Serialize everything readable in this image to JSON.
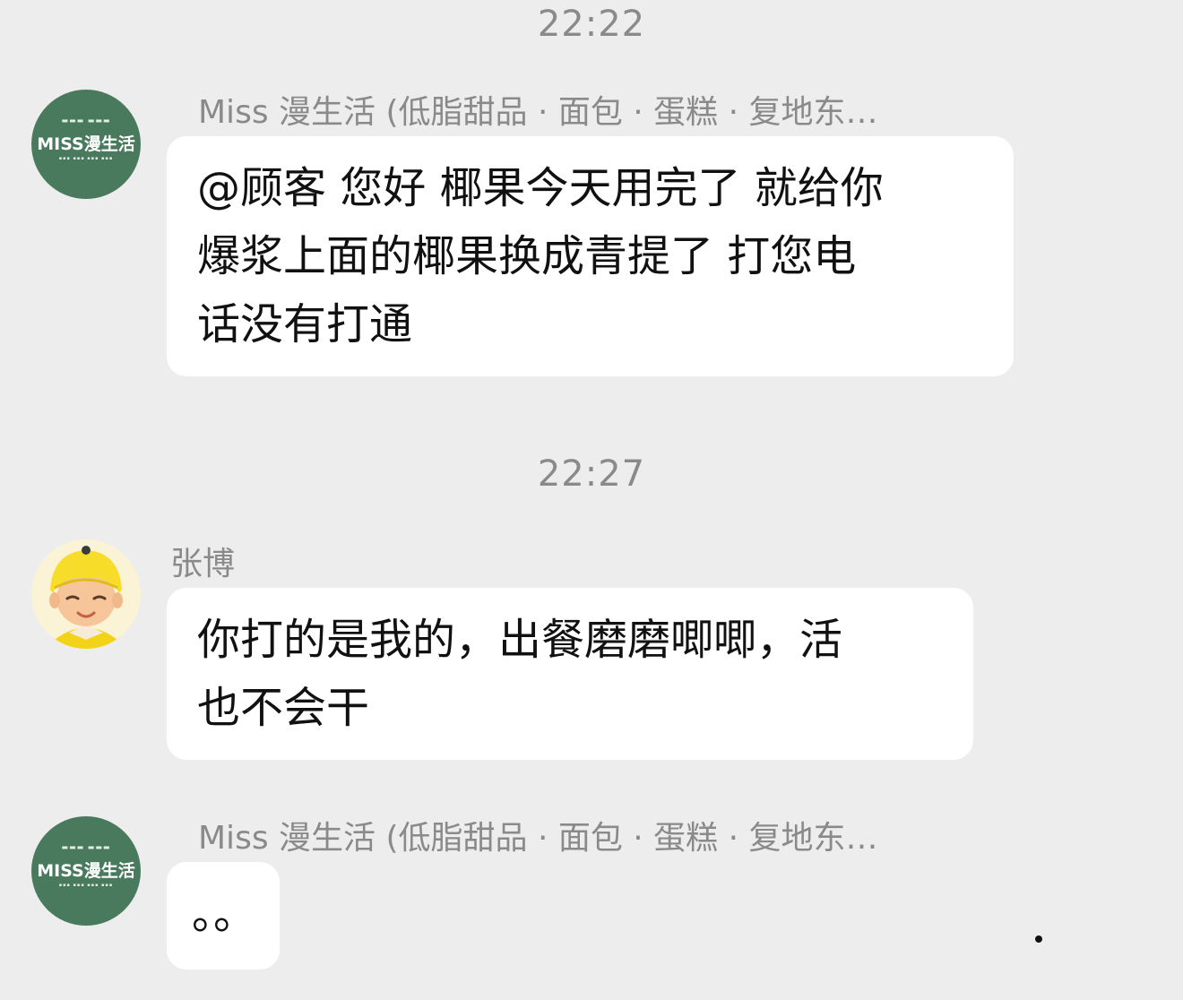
{
  "messages": [
    {
      "type": "time",
      "text": "22:22"
    },
    {
      "type": "message",
      "sender": "Miss 漫生活 (低脂甜品 · 面包 · 蛋糕 · 复地东…",
      "avatar": {
        "icon": "shop-logo-icon",
        "brand_text": "MISS漫生活",
        "color": "#4a7a5e"
      },
      "text": "@顾客 您好 椰果今天用完了 就给你\n爆浆上面的椰果换成青提了 打您电\n话没有打通"
    },
    {
      "type": "time",
      "text": "22:27"
    },
    {
      "type": "message",
      "sender": "张博",
      "avatar": {
        "icon": "courier-avatar-icon"
      },
      "text": "你打的是我的，出餐磨磨唧唧，活\n也不会干"
    },
    {
      "type": "message",
      "sender": "Miss 漫生活 (低脂甜品 · 面包 · 蛋糕 · 复地东…",
      "avatar": {
        "icon": "shop-logo-icon",
        "brand_text": "MISS漫生活",
        "color": "#4a7a5e"
      },
      "text": "。。"
    }
  ],
  "colors": {
    "background": "#ededed",
    "bubble": "#ffffff",
    "meta_text": "#8a8a8a",
    "message_text": "#111111",
    "shop_green": "#4a7a5e"
  }
}
